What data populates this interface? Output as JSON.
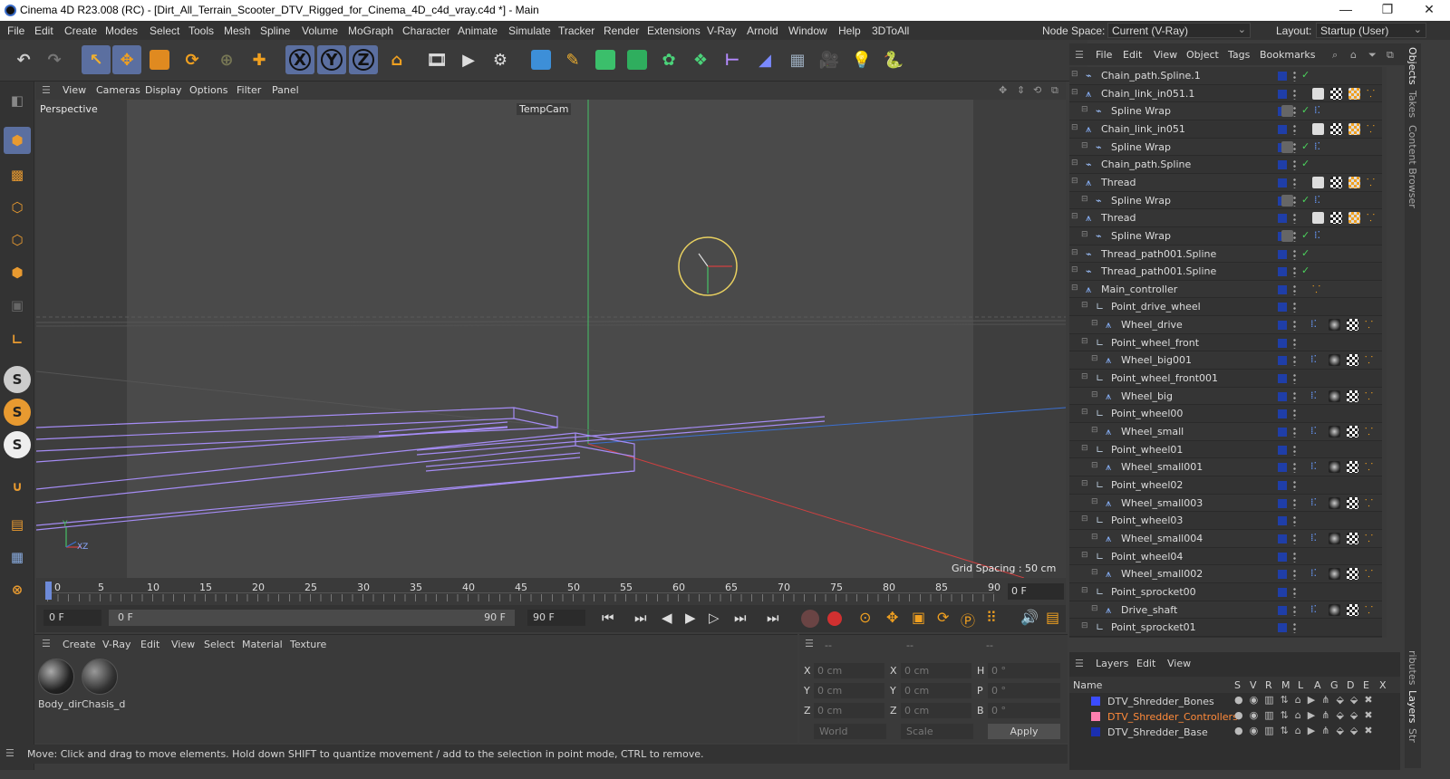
{
  "window": {
    "title": "Cinema 4D R23.008 (RC) - [Dirt_All_Terrain_Scooter_DTV_Rigged_for_Cinema_4D_c4d_vray.c4d *] - Main",
    "min": "—",
    "max": "❐",
    "close": "✕"
  },
  "menubar": {
    "items": [
      "File",
      "Edit",
      "Create",
      "Modes",
      "Select",
      "Tools",
      "Mesh",
      "Spline",
      "Volume",
      "MoGraph",
      "Character",
      "Animate",
      "Simulate",
      "Tracker",
      "Render",
      "Extensions",
      "V-Ray",
      "Arnold",
      "Window",
      "Help",
      "3DToAll"
    ],
    "node_space_label": "Node Space:",
    "node_space_value": "Current (V-Ray)",
    "layout_label": "Layout:",
    "layout_value": "Startup (User)"
  },
  "toolbar": {
    "axis_x": "X",
    "axis_y": "Y",
    "axis_z": "Z"
  },
  "viewport": {
    "menu": [
      "View",
      "Cameras",
      "Display",
      "Options",
      "Filter",
      "Panel"
    ],
    "label": "Perspective",
    "camera": "TempCam",
    "grid_spacing": "Grid Spacing : 50 cm",
    "axis_y": "Y",
    "axis_xz": "XZ"
  },
  "timeline": {
    "ticks": [
      "0",
      "5",
      "10",
      "15",
      "20",
      "25",
      "30",
      "35",
      "40",
      "45",
      "50",
      "55",
      "60",
      "65",
      "70",
      "75",
      "80",
      "85",
      "90"
    ],
    "current_frame": "0 F",
    "start_field": "0 F",
    "range_start": "0 F",
    "range_end": "90 F",
    "end_field": "90 F"
  },
  "material_panel": {
    "menu": [
      "Create",
      "V-Ray",
      "Edit",
      "View",
      "Select",
      "Material",
      "Texture"
    ],
    "materials": [
      "Body_dir",
      "Chasis_d"
    ]
  },
  "coord_panel": {
    "headers": [
      "--",
      "--",
      "--"
    ],
    "rows": [
      {
        "a": "X",
        "av": "0 cm",
        "b": "X",
        "bv": "0 cm",
        "c": "H",
        "cv": "0 °"
      },
      {
        "a": "Y",
        "av": "0 cm",
        "b": "Y",
        "bv": "0 cm",
        "c": "P",
        "cv": "0 °"
      },
      {
        "a": "Z",
        "av": "0 cm",
        "b": "Z",
        "bv": "0 cm",
        "c": "B",
        "cv": "0 °"
      }
    ],
    "world": "World",
    "scale": "Scale",
    "apply": "Apply"
  },
  "status": "Move: Click and drag to move elements. Hold down SHIFT to quantize movement / add to the selection in point mode, CTRL to remove.",
  "object_manager": {
    "menu": [
      "File",
      "Edit",
      "View",
      "Object",
      "Tags",
      "Bookmarks"
    ],
    "objects": [
      {
        "name": "Chain_path.Spline.1",
        "indent": 0,
        "type": "spline",
        "tags": "check"
      },
      {
        "name": "Chain_link_in051.1",
        "indent": 0,
        "type": "joint",
        "tags": "mat"
      },
      {
        "name": "Spline Wrap",
        "indent": 1,
        "type": "wrap",
        "tags": "wrap"
      },
      {
        "name": "Chain_link_in051",
        "indent": 0,
        "type": "joint",
        "tags": "mat"
      },
      {
        "name": "Spline Wrap",
        "indent": 1,
        "type": "wrap",
        "tags": "wrap"
      },
      {
        "name": "Chain_path.Spline",
        "indent": 0,
        "type": "spline",
        "tags": "check"
      },
      {
        "name": "Thread",
        "indent": 0,
        "type": "joint",
        "tags": "mat"
      },
      {
        "name": "Spline Wrap",
        "indent": 1,
        "type": "wrap",
        "tags": "wrap"
      },
      {
        "name": "Thread",
        "indent": 0,
        "type": "joint",
        "tags": "mat"
      },
      {
        "name": "Spline Wrap",
        "indent": 1,
        "type": "wrap",
        "tags": "wrap"
      },
      {
        "name": "Thread_path001.Spline",
        "indent": 0,
        "type": "spline",
        "tags": "check"
      },
      {
        "name": "Thread_path001.Spline",
        "indent": 0,
        "type": "spline",
        "tags": "check"
      },
      {
        "name": "Main_controller",
        "indent": 0,
        "type": "null",
        "tags": "ctrl"
      },
      {
        "name": "Point_drive_wheel",
        "indent": 1,
        "type": "point",
        "tags": "none"
      },
      {
        "name": "Wheel_drive",
        "indent": 2,
        "type": "joint",
        "tags": "wheel"
      },
      {
        "name": "Point_wheel_front",
        "indent": 1,
        "type": "point",
        "tags": "none"
      },
      {
        "name": "Wheel_big001",
        "indent": 2,
        "type": "joint",
        "tags": "wheel"
      },
      {
        "name": "Point_wheel_front001",
        "indent": 1,
        "type": "point",
        "tags": "none"
      },
      {
        "name": "Wheel_big",
        "indent": 2,
        "type": "joint",
        "tags": "wheel"
      },
      {
        "name": "Point_wheel00",
        "indent": 1,
        "type": "point",
        "tags": "none"
      },
      {
        "name": "Wheel_small",
        "indent": 2,
        "type": "joint",
        "tags": "wheel"
      },
      {
        "name": "Point_wheel01",
        "indent": 1,
        "type": "point",
        "tags": "none"
      },
      {
        "name": "Wheel_small001",
        "indent": 2,
        "type": "joint",
        "tags": "wheel"
      },
      {
        "name": "Point_wheel02",
        "indent": 1,
        "type": "point",
        "tags": "none"
      },
      {
        "name": "Wheel_small003",
        "indent": 2,
        "type": "joint",
        "tags": "wheel"
      },
      {
        "name": "Point_wheel03",
        "indent": 1,
        "type": "point",
        "tags": "none"
      },
      {
        "name": "Wheel_small004",
        "indent": 2,
        "type": "joint",
        "tags": "wheel"
      },
      {
        "name": "Point_wheel04",
        "indent": 1,
        "type": "point",
        "tags": "none"
      },
      {
        "name": "Wheel_small002",
        "indent": 2,
        "type": "joint",
        "tags": "wheel"
      },
      {
        "name": "Point_sprocket00",
        "indent": 1,
        "type": "point",
        "tags": "none"
      },
      {
        "name": "Drive_shaft",
        "indent": 2,
        "type": "joint",
        "tags": "wheel"
      },
      {
        "name": "Point_sprocket01",
        "indent": 1,
        "type": "point",
        "tags": "none"
      }
    ]
  },
  "layers": {
    "menu": [
      "Layers",
      "Edit",
      "View"
    ],
    "name_header": "Name",
    "col_headers": [
      "S",
      "V",
      "R",
      "M",
      "L",
      "A",
      "G",
      "D",
      "E",
      "X"
    ],
    "items": [
      {
        "name": "DTV_Shredder_Bones",
        "color": "#3b4cff",
        "text_color": "#dcdcdc"
      },
      {
        "name": "DTV_Shredder_Controllers",
        "color": "#ff7fb0",
        "text_color": "#ff8a3a"
      },
      {
        "name": "DTV_Shredder_Base",
        "color": "#1a2fb0",
        "text_color": "#dcdcdc"
      }
    ]
  },
  "right_tabs": [
    "Objects",
    "Takes",
    "Content Browser",
    "ributes",
    "Layers",
    "Str"
  ]
}
